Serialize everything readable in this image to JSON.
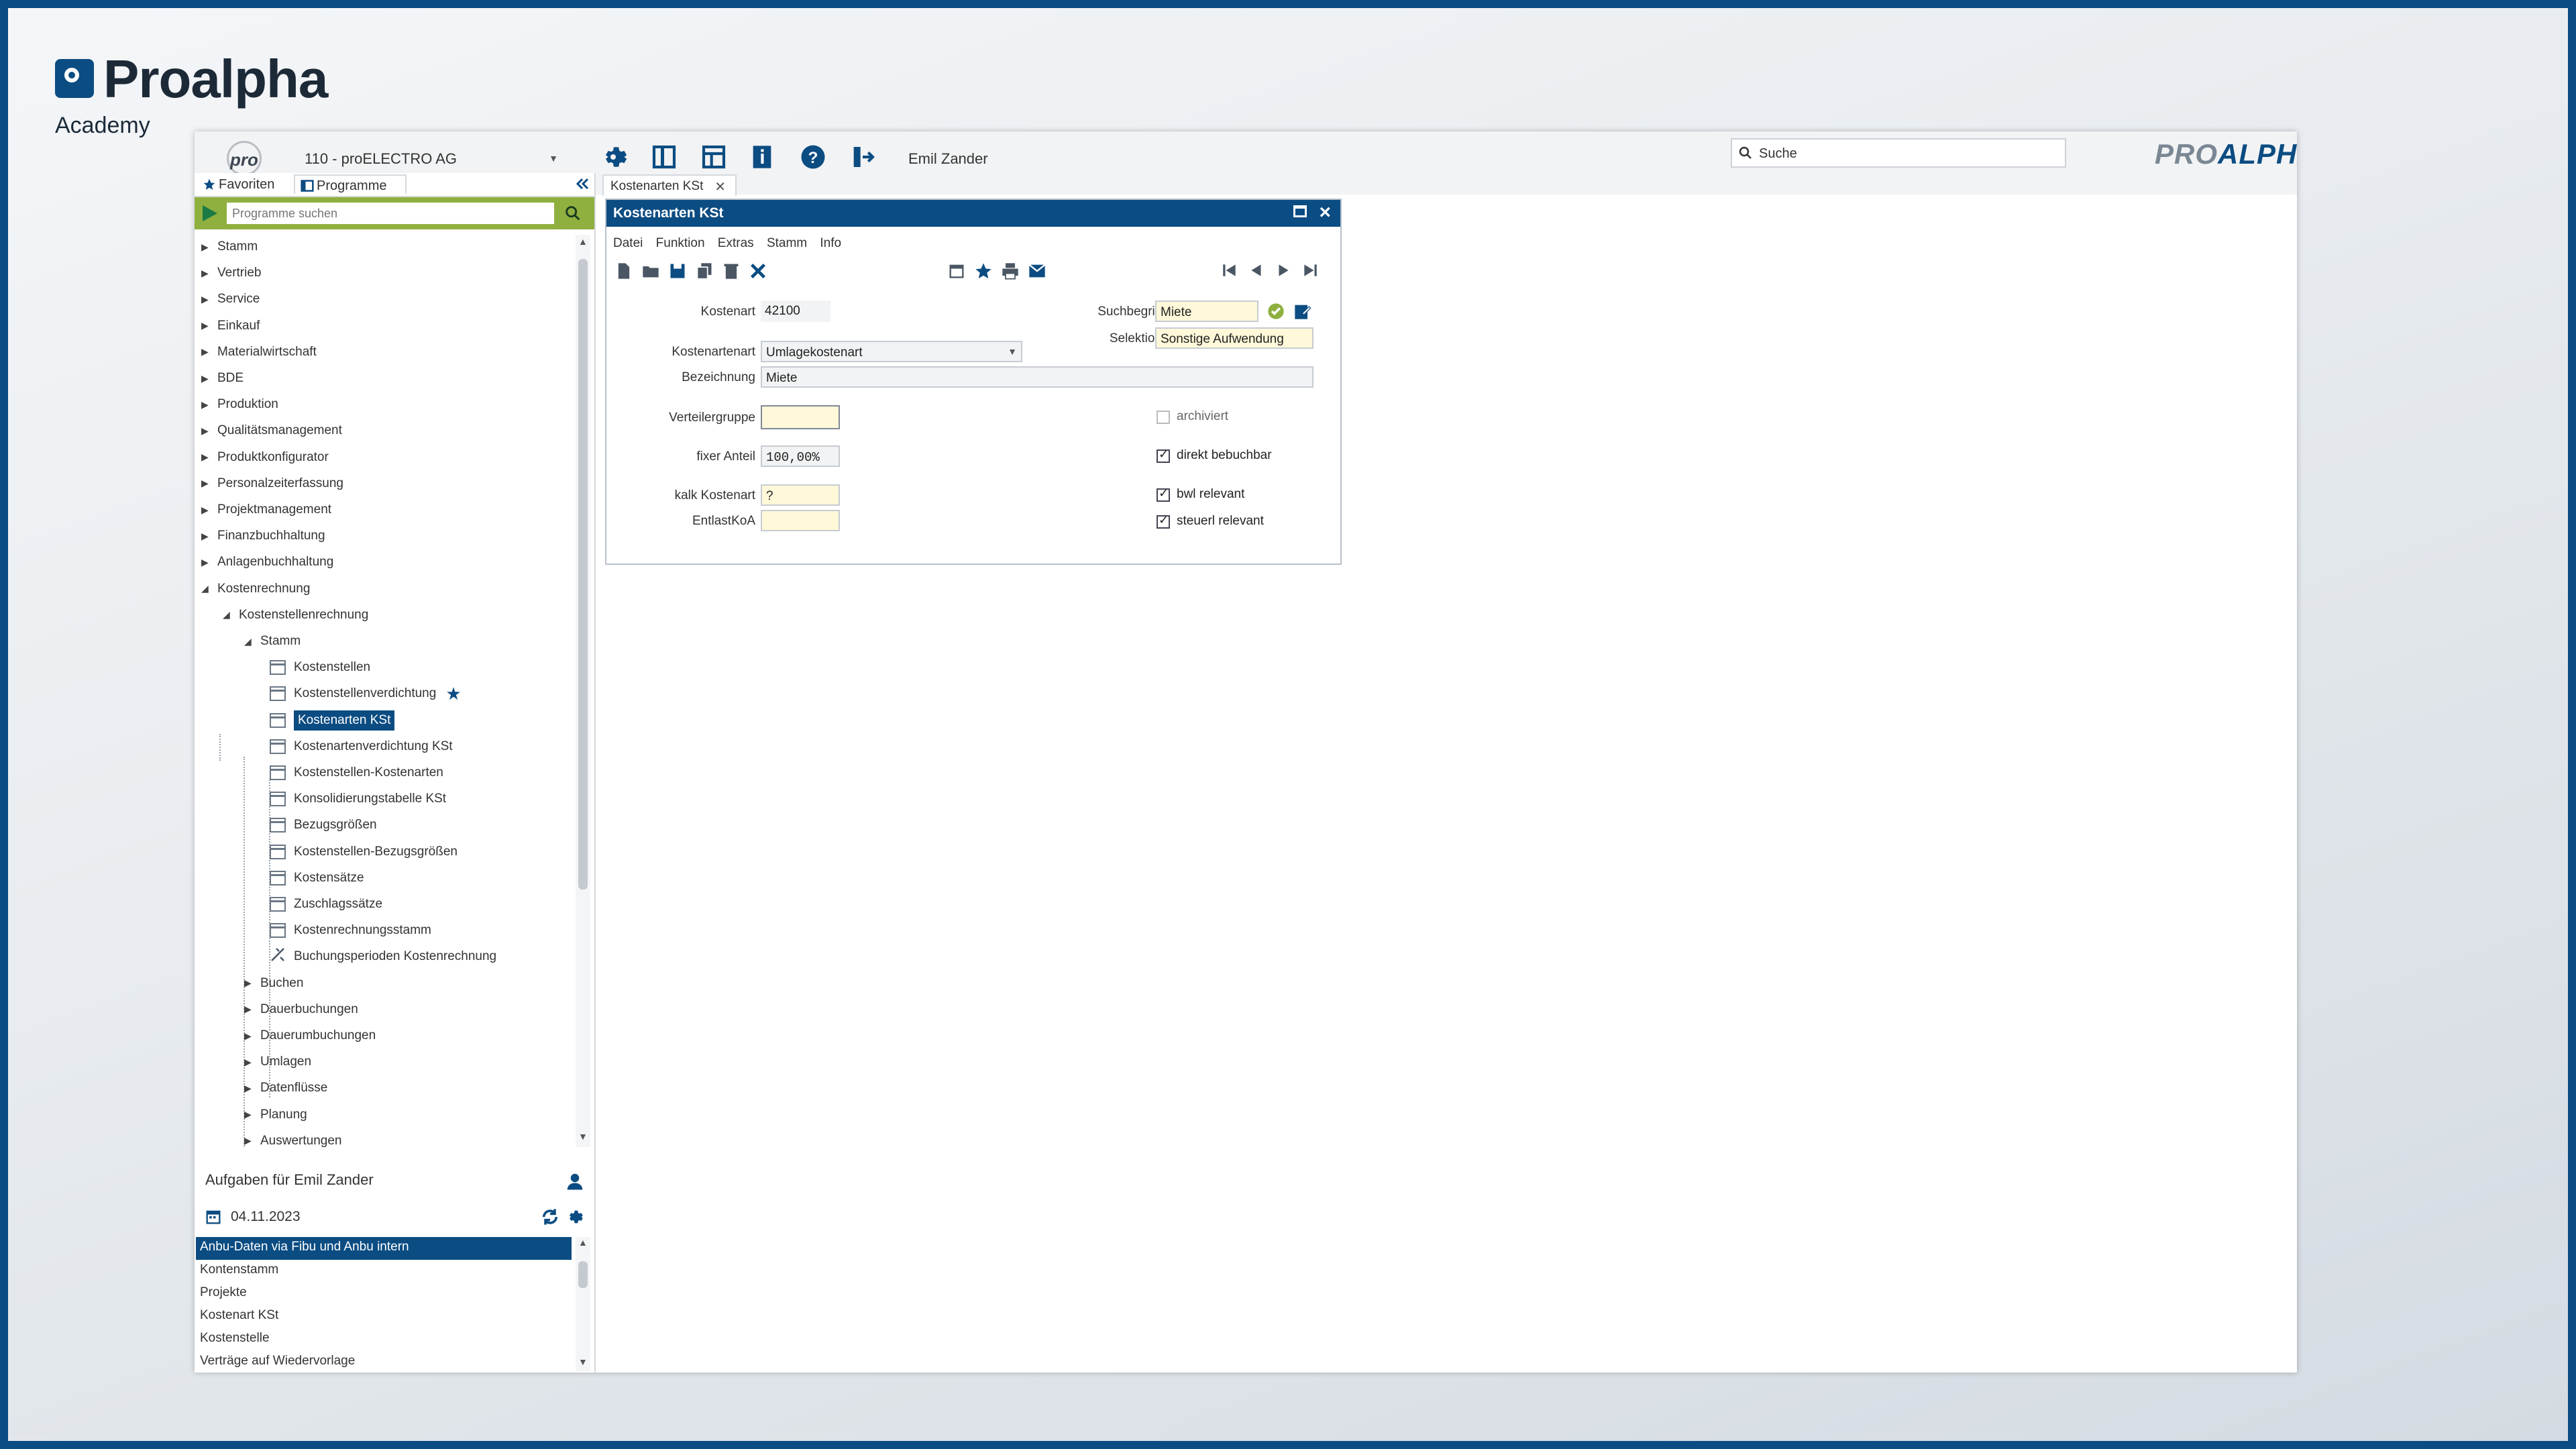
{
  "brand": {
    "name": "Proalpha",
    "sub": "Academy"
  },
  "topbar": {
    "logo": "pro",
    "company": "110 - proELECTRO AG",
    "user": "Emil Zander",
    "search_placeholder": "Suche",
    "logo_p1": "PRO",
    "logo_p2": "ALPHA"
  },
  "left": {
    "tabs": [
      "Favoriten",
      "Programme"
    ],
    "search_placeholder": "Programme suchen",
    "tree": [
      {
        "label": "Stamm",
        "level": 0,
        "type": "closed"
      },
      {
        "label": "Vertrieb",
        "level": 0,
        "type": "closed"
      },
      {
        "label": "Service",
        "level": 0,
        "type": "closed"
      },
      {
        "label": "Einkauf",
        "level": 0,
        "type": "closed"
      },
      {
        "label": "Materialwirtschaft",
        "level": 0,
        "type": "closed"
      },
      {
        "label": "BDE",
        "level": 0,
        "type": "closed"
      },
      {
        "label": "Produktion",
        "level": 0,
        "type": "closed"
      },
      {
        "label": "Qualitätsmanagement",
        "level": 0,
        "type": "closed"
      },
      {
        "label": "Produktkonfigurator",
        "level": 0,
        "type": "closed"
      },
      {
        "label": "Personalzeiterfassung",
        "level": 0,
        "type": "closed"
      },
      {
        "label": "Projektmanagement",
        "level": 0,
        "type": "closed"
      },
      {
        "label": "Finanzbuchhaltung",
        "level": 0,
        "type": "closed"
      },
      {
        "label": "Anlagenbuchhaltung",
        "level": 0,
        "type": "closed"
      },
      {
        "label": "Kostenrechnung",
        "level": 0,
        "type": "open"
      },
      {
        "label": "Kostenstellenrechnung",
        "level": 1,
        "type": "open"
      },
      {
        "label": "Stamm",
        "level": 2,
        "type": "open"
      },
      {
        "label": "Kostenstellen",
        "level": 3,
        "type": "leaf"
      },
      {
        "label": "Kostenstellenverdichtung",
        "level": 3,
        "type": "leaf",
        "star": true
      },
      {
        "label": "Kostenarten KSt",
        "level": 3,
        "type": "leaf",
        "selected": true
      },
      {
        "label": "Kostenartenverdichtung KSt",
        "level": 3,
        "type": "leaf"
      },
      {
        "label": "Kostenstellen-Kostenarten",
        "level": 3,
        "type": "leaf"
      },
      {
        "label": "Konsolidierungstabelle KSt",
        "level": 3,
        "type": "leaf"
      },
      {
        "label": "Bezugsgrößen",
        "level": 3,
        "type": "leaf"
      },
      {
        "label": "Kostenstellen-Bezugsgrößen",
        "level": 3,
        "type": "leaf"
      },
      {
        "label": "Kostensätze",
        "level": 3,
        "type": "leaf"
      },
      {
        "label": "Zuschlagssätze",
        "level": 3,
        "type": "leaf"
      },
      {
        "label": "Kostenrechnungsstamm",
        "level": 3,
        "type": "leaf"
      },
      {
        "label": "Buchungsperioden Kostenrechnung",
        "level": 3,
        "type": "tool"
      },
      {
        "label": "Buchen",
        "level": 2,
        "type": "closed"
      },
      {
        "label": "Dauerbuchungen",
        "level": 2,
        "type": "closed"
      },
      {
        "label": "Dauerumbuchungen",
        "level": 2,
        "type": "closed"
      },
      {
        "label": "Umlagen",
        "level": 2,
        "type": "closed"
      },
      {
        "label": "Datenflüsse",
        "level": 2,
        "type": "closed"
      },
      {
        "label": "Planung",
        "level": 2,
        "type": "closed"
      },
      {
        "label": "Auswertungen",
        "level": 2,
        "type": "closed"
      }
    ]
  },
  "tasks": {
    "title": "Aufgaben für Emil Zander",
    "date": "04.11.2023",
    "items": [
      "Anbu-Daten via Fibu und Anbu intern",
      "Kontenstamm",
      "Projekte",
      "Kostenart KSt",
      "Kostenstelle",
      "Verträge auf Wiedervorlage"
    ]
  },
  "content_tab": "Kostenarten KSt",
  "form": {
    "title": "Kostenarten KSt",
    "menu": [
      "Datei",
      "Funktion",
      "Extras",
      "Stamm",
      "Info"
    ],
    "labels": {
      "kostenart": "Kostenart",
      "kostenartenart": "Kostenartenart",
      "bezeichnung": "Bezeichnung",
      "verteilergruppe": "Verteilergruppe",
      "fixer_anteil": "fixer Anteil",
      "kalk_kostenart": "kalk Kostenart",
      "entlastkoa": "EntlastKoA",
      "suchbegriff": "Suchbegriff",
      "selektion": "Selektion"
    },
    "values": {
      "kostenart": "42100",
      "kostenartenart": "Umlagekostenart",
      "bezeichnung": "Miete",
      "verteilergruppe": "",
      "fixer_anteil": "100,00%",
      "kalk_kostenart": "?",
      "entlastkoa": "",
      "suchbegriff": "Miete",
      "selektion": "Sonstige Aufwendung"
    },
    "checkboxes": [
      {
        "label": "archiviert",
        "checked": false
      },
      {
        "label": "direkt bebuchbar",
        "checked": true
      },
      {
        "label": "bwl relevant",
        "checked": true
      },
      {
        "label": "steuerl relevant",
        "checked": true
      }
    ]
  },
  "colors": {
    "accent": "#0b4c82",
    "search_bar": "#8fb03f",
    "field_yellow": "#fff8d9"
  }
}
